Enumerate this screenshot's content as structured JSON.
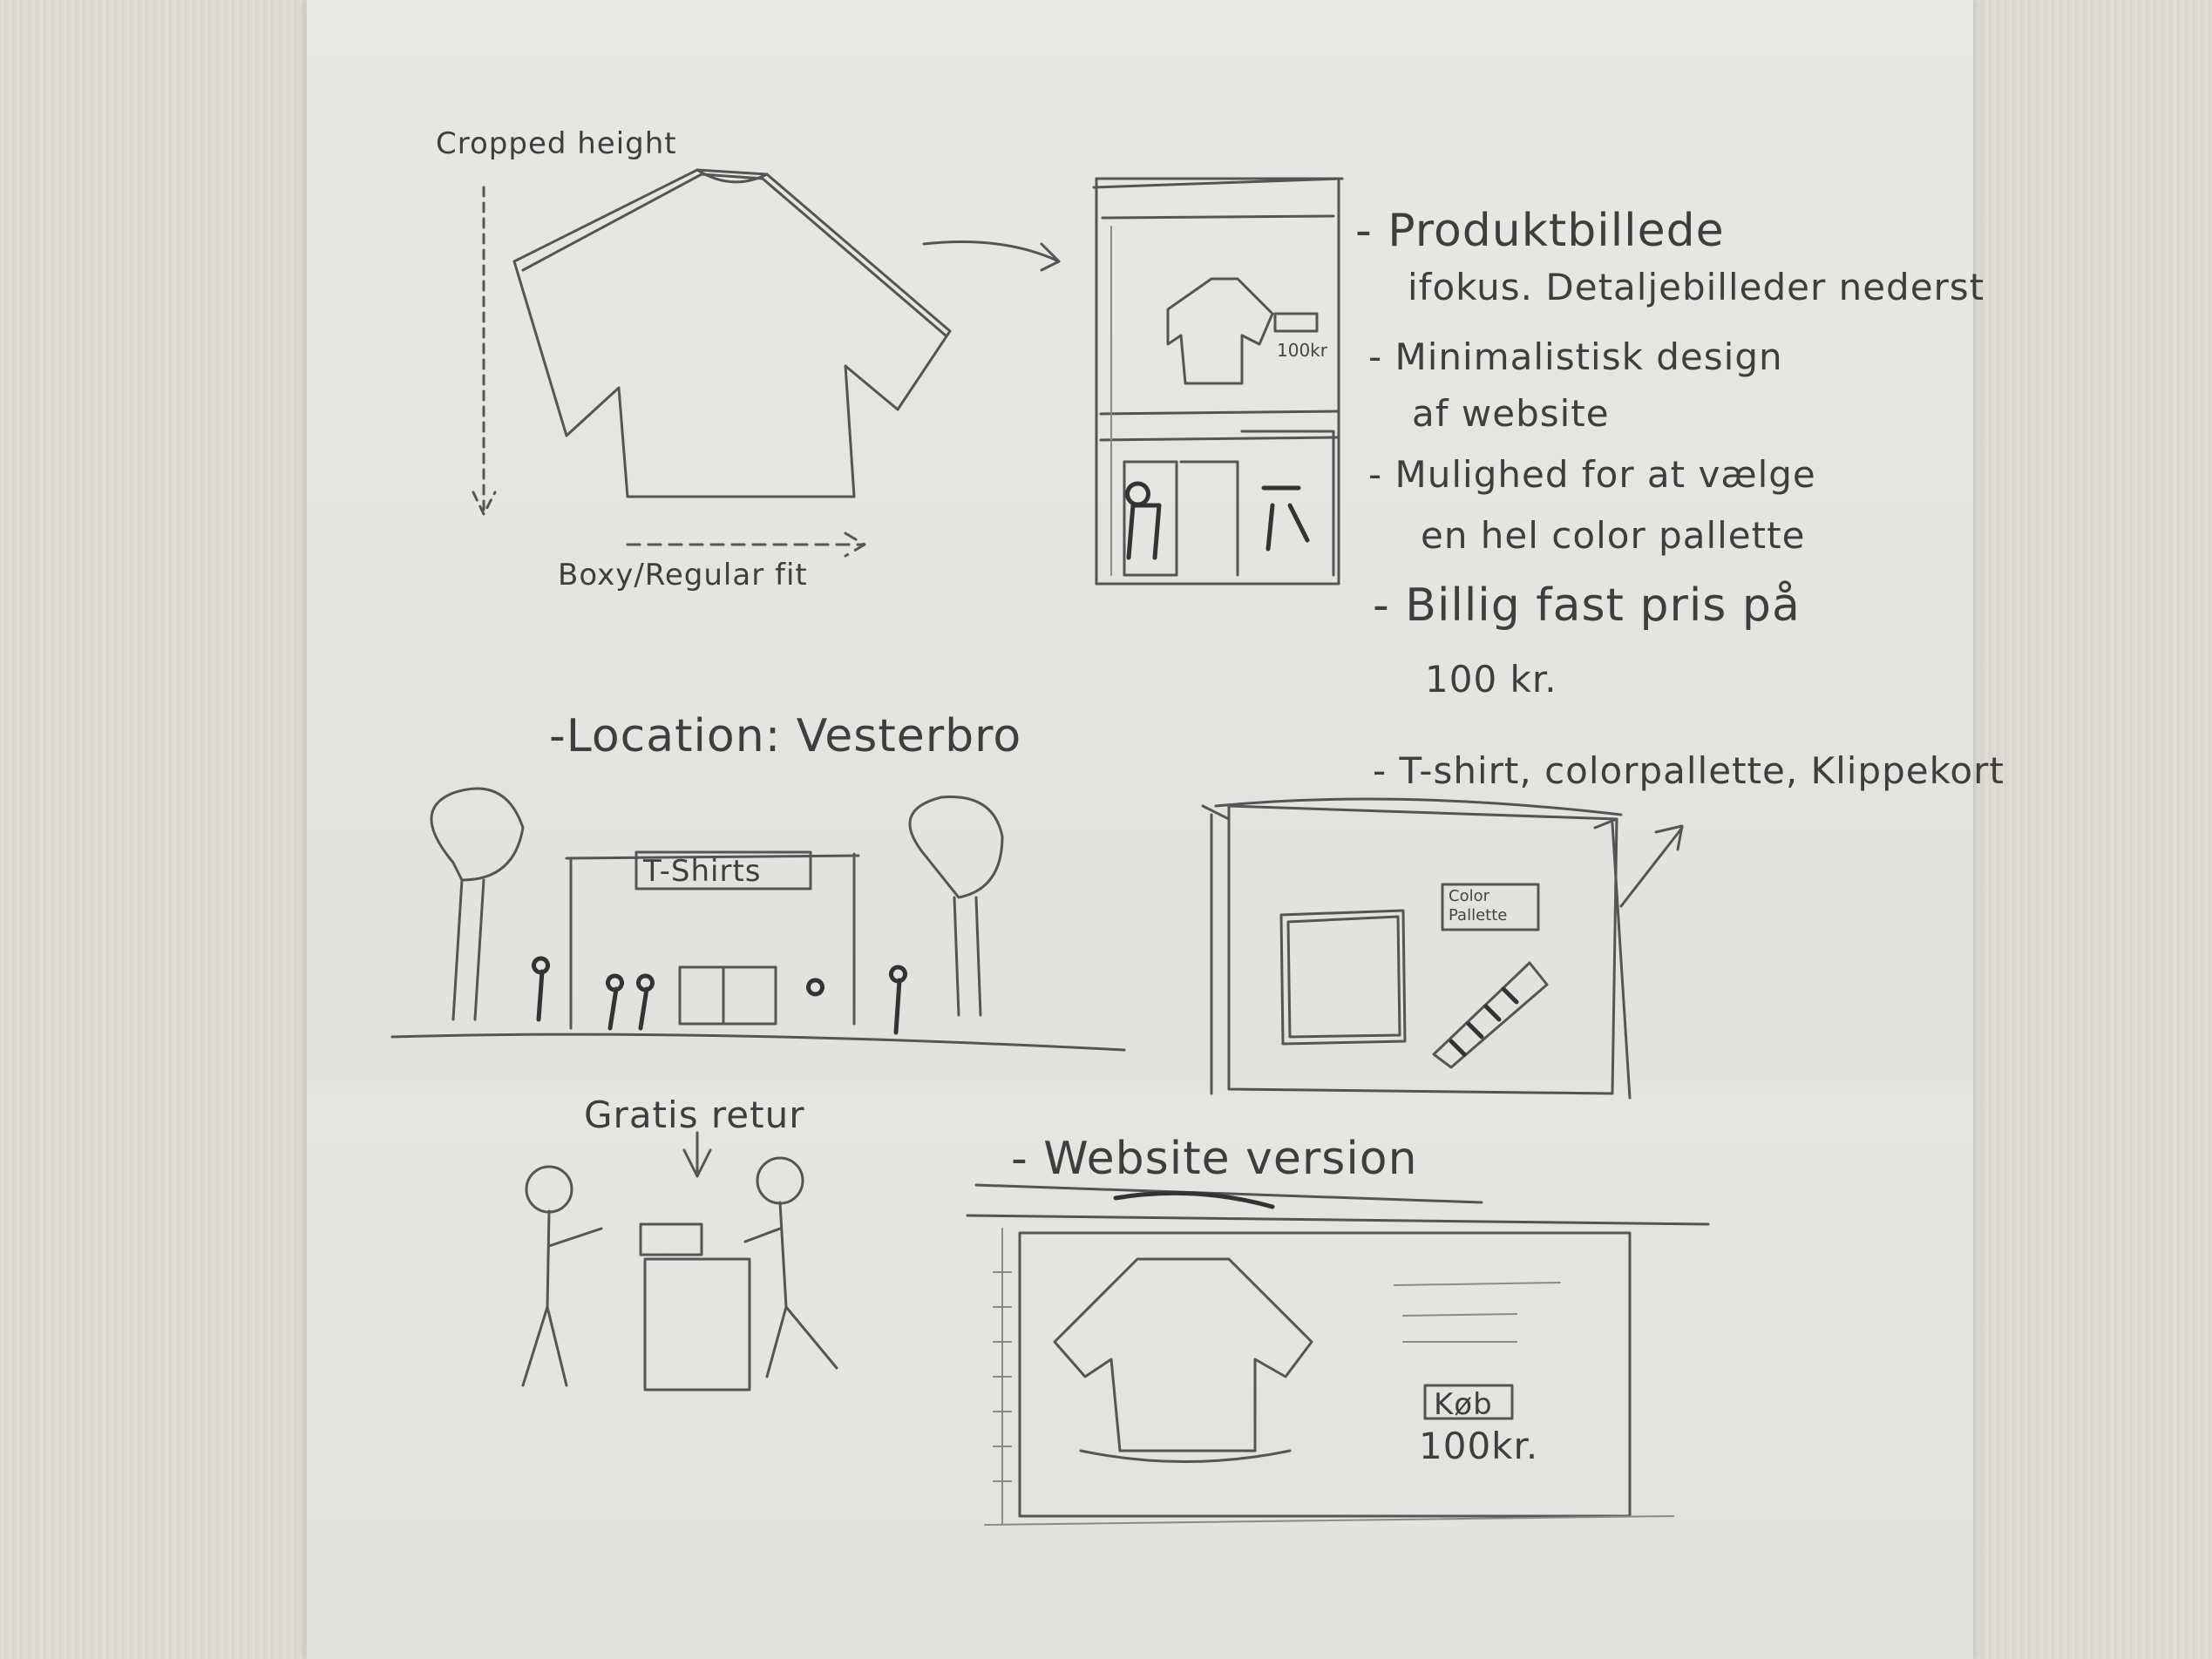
{
  "sketch_labels": {
    "cropped_height": "Cropped height",
    "boxy_fit": "Boxy/Regular fit",
    "location": "-Location: Vesterbro",
    "tshirts_sign": "T-Shirts",
    "gratis_retur": "Gratis retur",
    "website_version": "- Website version",
    "mobile_price": "100kr",
    "color_pallette_box": "Color Pallette",
    "website_buy_button": "Køb",
    "website_price": "100kr."
  },
  "notes": [
    {
      "line1": "- Produktbillede",
      "line2": "ifokus. Detaljebilleder nederst"
    },
    {
      "line1": "- Minimalistisk design",
      "line2": "af website"
    },
    {
      "line1": "- Mulighed for at vælge",
      "line2": "en hel color pallette"
    },
    {
      "line1": "- Billig fast pris på",
      "line2": "100 kr."
    },
    {
      "line1": "- T-shirt, colorpallette, Klippekort",
      "line2": ""
    }
  ]
}
